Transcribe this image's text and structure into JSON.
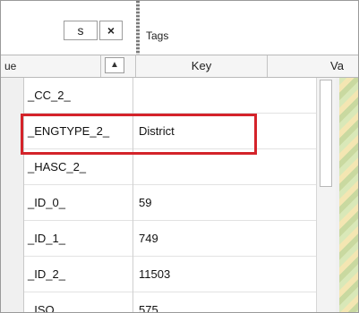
{
  "toolbar": {
    "s_label": "s",
    "close_label": "×"
  },
  "tags": {
    "label": "Tags"
  },
  "table": {
    "left_header": "ue",
    "key_header": "Key",
    "value_header": "Va",
    "sort_glyph": "▲",
    "rows": [
      {
        "name": "_CC_2_",
        "value": ""
      },
      {
        "name": "_ENGTYPE_2_",
        "value": "District"
      },
      {
        "name": "_HASC_2_",
        "value": ""
      },
      {
        "name": "_ID_0_",
        "value": "59"
      },
      {
        "name": "_ID_1_",
        "value": "749"
      },
      {
        "name": "_ID_2_",
        "value": "11503"
      },
      {
        "name": "_ISO_",
        "value": "575"
      }
    ]
  }
}
